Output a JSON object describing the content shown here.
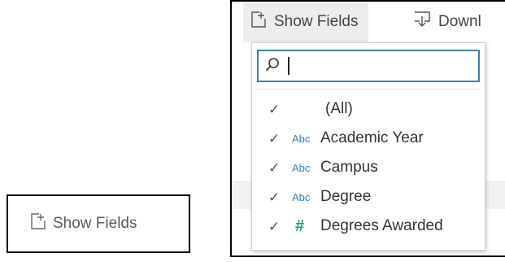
{
  "left_panel": {
    "show_fields_label": "Show Fields"
  },
  "toolbar": {
    "show_fields_label": "Show Fields",
    "download_label": "Downl"
  },
  "search": {
    "value": "",
    "placeholder": ""
  },
  "fields": [
    {
      "label": "(All)",
      "type": "",
      "checked": true
    },
    {
      "label": "Academic Year",
      "type": "Abc",
      "checked": true
    },
    {
      "label": "Campus",
      "type": "Abc",
      "checked": true
    },
    {
      "label": "Degree",
      "type": "Abc",
      "checked": true
    },
    {
      "label": "Degrees Awarded",
      "type": "#",
      "checked": true
    }
  ],
  "colors": {
    "search_border": "#3b7fb4",
    "string_type": "#3a7bbd",
    "number_type": "#1ea37e",
    "active_button_bg": "#ededed"
  },
  "icons": {
    "show_fields": "plus-box-icon",
    "download": "download-icon",
    "search": "search-icon",
    "check": "check-icon"
  }
}
